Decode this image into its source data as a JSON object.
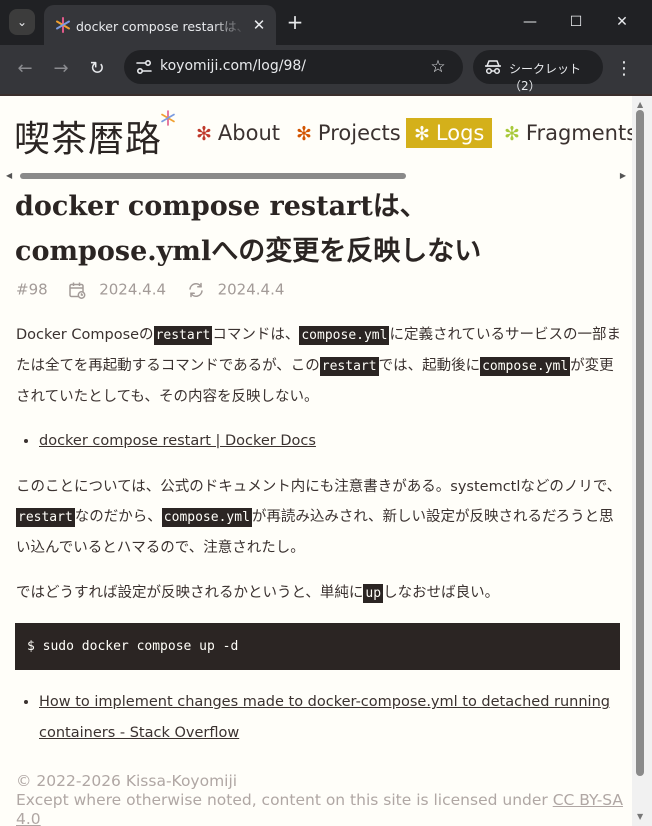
{
  "browser": {
    "tab_title": "docker compose restartは、compose.ymlへの変更を反映しない",
    "tab_close": "✕",
    "new_tab": "+",
    "tab_list": "⌄",
    "url": "koyomiji.com/log/98/",
    "incognito_label": "シークレット（2）",
    "window_controls": {
      "minimize": "—",
      "maximize": "☐",
      "close": "✕"
    },
    "nav": {
      "back": "←",
      "forward": "→",
      "reload": "↻",
      "star": "☆",
      "menu": "⋮"
    },
    "icons": [
      "tab-favicon-icon",
      "site-info-icon",
      "star-icon",
      "incognito-icon",
      "menu-icon"
    ]
  },
  "site": {
    "logo": "喫茶暦路",
    "nav": [
      {
        "label": "About",
        "color": "#c0392b"
      },
      {
        "label": "Projects",
        "color": "#d35400"
      },
      {
        "label": "Logs",
        "color": "#fffef9"
      },
      {
        "label": "Fragments",
        "color": "#a8c93a"
      }
    ],
    "accent": "#d4b01a"
  },
  "article": {
    "title": "docker compose restartは、compose.ymlへの変更を反映しない",
    "number": "#98",
    "created": "2024.4.4",
    "updated": "2024.4.4",
    "p1": {
      "t1": "Docker Composeの",
      "c1": "restart",
      "t2": "コマンドは、",
      "c2": "compose.yml",
      "t3": "に定義されているサービスの一部または全てを再起動するコマンドであるが、この",
      "c3": "restart",
      "t4": "では、起動後に",
      "c4": "compose.yml",
      "t5": "が変更されていたとしても、その内容を反映しない。"
    },
    "link1": "docker compose restart | Docker Docs",
    "p2": {
      "t1": "このことについては、公式のドキュメント内にも注意書きがある。systemctlなどのノリで、",
      "c1": "restart",
      "t2": "なのだから、",
      "c2": "compose.yml",
      "t3": "が再読み込みされ、新しい設定が反映されるだろうと思い込んでいるとハマるので、注意されたし。"
    },
    "p3": {
      "t1": "ではどうすれば設定が反映されるかというと、単純に",
      "c1": "up",
      "t2": "しなおせば良い。"
    },
    "code": "$ sudo docker compose up -d",
    "link2": "How to implement changes made to docker-compose.yml to detached running containers - Stack Overflow"
  },
  "footer": {
    "copyright": "© 2022-2026 Kissa-Koyomiji",
    "license_prefix": "Except where otherwise noted, content on this site is licensed under ",
    "license_link": "CC BY-SA 4.0"
  }
}
